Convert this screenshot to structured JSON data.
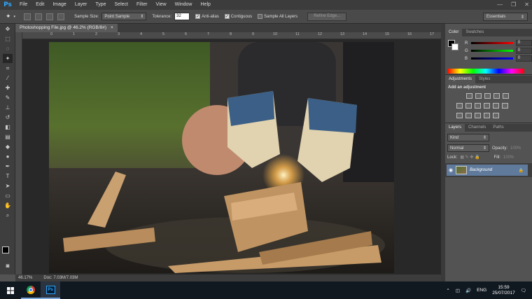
{
  "app": {
    "logo": "Ps",
    "menus": [
      "File",
      "Edit",
      "Image",
      "Layer",
      "Type",
      "Select",
      "Filter",
      "View",
      "Window",
      "Help"
    ],
    "window_buttons": [
      "—",
      "❐",
      "✕"
    ]
  },
  "options": {
    "sample_size_label": "Sample Size:",
    "sample_size_value": "Point Sample",
    "tolerance_label": "Tolerance:",
    "tolerance_value": "32",
    "anti_alias": "Anti-alias",
    "contiguous": "Contiguous",
    "sample_all": "Sample All Layers",
    "refine_edge": "Refine Edge...",
    "workspace": "Essentials"
  },
  "document": {
    "tab_title": "Photoshopping File.jpg @ 46.2% (RGB/8#)",
    "close": "×",
    "ruler_ticks": [
      "0",
      "1",
      "2",
      "3",
      "4",
      "5",
      "6",
      "7",
      "8",
      "9",
      "10",
      "11",
      "12",
      "13",
      "14",
      "15",
      "16",
      "17"
    ],
    "zoom": "46.17%",
    "doc_size": "Doc: 7.03M/7.03M"
  },
  "panels": {
    "color_tabs": [
      "Color",
      "Swatches"
    ],
    "rgb": [
      {
        "letter": "R",
        "value": "0"
      },
      {
        "letter": "G",
        "value": "0"
      },
      {
        "letter": "B",
        "value": "0"
      }
    ],
    "adj_tabs": [
      "Adjustments",
      "Styles"
    ],
    "add_adjustment": "Add an adjustment",
    "layer_tabs": [
      "Layers",
      "Channels",
      "Paths"
    ],
    "kind": "Kind",
    "blend_mode": "Normal",
    "opacity_label": "Opacity:",
    "opacity_value": "100%",
    "lock_label": "Lock:",
    "fill_label": "Fill:",
    "fill_value": "100%",
    "layer_name": "Background"
  },
  "taskbar": {
    "lang": "ENG",
    "time": "15:59",
    "date": "25/07/2017"
  },
  "colors": {
    "accent": "#31a8ff",
    "panel": "#535353",
    "selected_layer": "#607a9c"
  }
}
